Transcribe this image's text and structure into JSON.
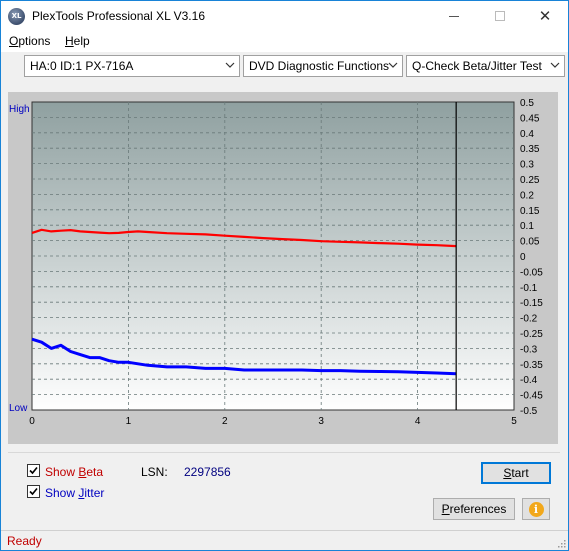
{
  "window": {
    "title": "PlexTools Professional XL V3.16",
    "icon_text": "XL"
  },
  "menu": {
    "options_label": "Options",
    "options_mnemonic": "O",
    "options_rest": "ptions",
    "help_label": "Help",
    "help_mnemonic": "H",
    "help_rest": "elp"
  },
  "toolbar": {
    "drive": "HA:0 ID:1  PX-716A",
    "function": "DVD Diagnostic Functions",
    "test": "Q-Check Beta/Jitter Test"
  },
  "chart_data": {
    "type": "line",
    "x_axis": {
      "min": 0,
      "max": 5,
      "ticks": [
        "0",
        "1",
        "2",
        "3",
        "4",
        "5"
      ]
    },
    "left_axis": {
      "high_label": "High",
      "low_label": "Low"
    },
    "right_axis": {
      "min": -0.5,
      "max": 0.5,
      "ticks": [
        "0.5",
        "0.45",
        "0.4",
        "0.35",
        "0.3",
        "0.25",
        "0.2",
        "0.15",
        "0.1",
        "0.05",
        "0",
        "-0.05",
        "-0.1",
        "-0.15",
        "-0.2",
        "-0.25",
        "-0.3",
        "-0.35",
        "-0.4",
        "-0.45",
        "-0.5"
      ]
    },
    "end_marker_x": 4.4,
    "grid": true,
    "series": [
      {
        "color": "#ff0000",
        "x": [
          0.0,
          0.1,
          0.2,
          0.3,
          0.4,
          0.5,
          0.6,
          0.7,
          0.8,
          0.9,
          1.0,
          1.1,
          1.2,
          1.4,
          1.6,
          1.8,
          2.0,
          2.2,
          2.4,
          2.6,
          2.8,
          3.0,
          3.2,
          3.4,
          3.6,
          3.8,
          4.0,
          4.2,
          4.4
        ],
        "y": [
          0.075,
          0.085,
          0.08,
          0.082,
          0.084,
          0.08,
          0.078,
          0.076,
          0.074,
          0.075,
          0.078,
          0.08,
          0.078,
          0.074,
          0.072,
          0.07,
          0.066,
          0.062,
          0.058,
          0.055,
          0.052,
          0.048,
          0.046,
          0.044,
          0.042,
          0.04,
          0.037,
          0.035,
          0.032
        ]
      },
      {
        "color": "#0000ff",
        "x": [
          0.0,
          0.1,
          0.2,
          0.3,
          0.4,
          0.5,
          0.6,
          0.7,
          0.8,
          0.9,
          1.0,
          1.1,
          1.2,
          1.4,
          1.6,
          1.8,
          2.0,
          2.2,
          2.4,
          2.6,
          2.8,
          3.0,
          3.2,
          3.4,
          3.6,
          3.8,
          4.0,
          4.2,
          4.4
        ],
        "y": [
          -0.27,
          -0.28,
          -0.3,
          -0.29,
          -0.31,
          -0.32,
          -0.33,
          -0.33,
          -0.34,
          -0.345,
          -0.345,
          -0.35,
          -0.355,
          -0.36,
          -0.36,
          -0.365,
          -0.365,
          -0.37,
          -0.37,
          -0.37,
          -0.37,
          -0.372,
          -0.372,
          -0.374,
          -0.375,
          -0.376,
          -0.378,
          -0.38,
          -0.382
        ]
      }
    ]
  },
  "options": {
    "show_beta_label": "Show Beta",
    "show_beta_pre": "Show ",
    "show_beta_mnemonic": "B",
    "show_beta_post": "eta",
    "show_jitter_label": "Show Jitter",
    "show_jitter_pre": "Show ",
    "show_jitter_mnemonic": "J",
    "show_jitter_post": "itter",
    "show_beta_checked": true,
    "show_jitter_checked": true,
    "lsn_label": "LSN:",
    "lsn_value": "2297856"
  },
  "buttons": {
    "start": "Start",
    "start_mnemonic": "S",
    "start_rest": "tart",
    "preferences": "Preferences",
    "preferences_mnemonic": "P",
    "preferences_rest": "references"
  },
  "status": {
    "text": "Ready"
  },
  "colors": {
    "beta": "#ff0000",
    "jitter": "#0000ff",
    "status_text": "#c00000"
  }
}
